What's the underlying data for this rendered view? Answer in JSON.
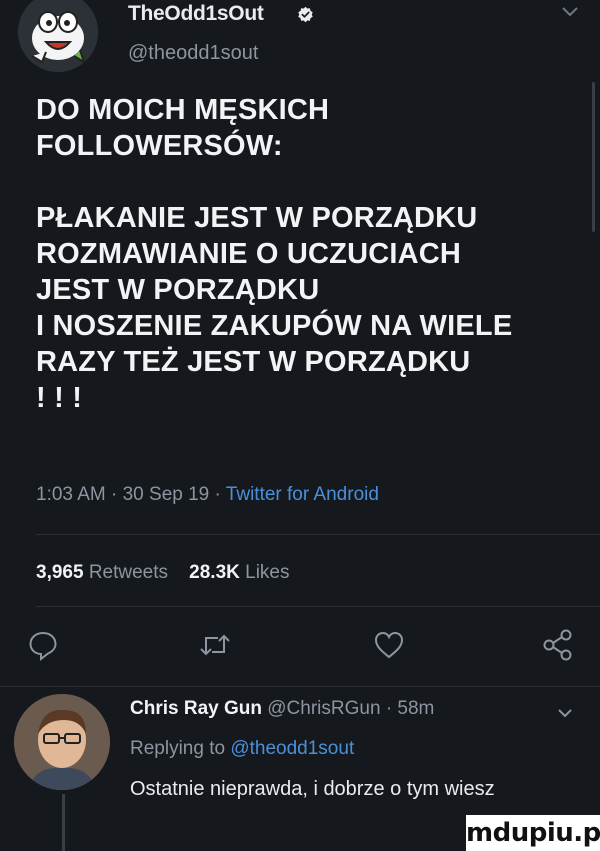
{
  "author": {
    "display_name": "TheOdd1sOut",
    "handle": "@theodd1sout",
    "verified": true
  },
  "tweet": {
    "lines_block1": [
      "DO MOICH MĘSKICH",
      "FOLLOWERSÓW:"
    ],
    "lines_block2": [
      "PŁAKANIE JEST W PORZĄDKU",
      "ROZMAWIANIE O UCZUCIACH",
      "JEST W PORZĄDKU",
      "I NOSZENIE ZAKUPÓW NA WIELE",
      "RAZY TEŻ JEST W PORZĄDKU",
      "! ! !"
    ],
    "time": "1:03 AM",
    "date": "30 Sep 19",
    "source": "Twitter for Android"
  },
  "stats": {
    "retweets_count": "3,965",
    "retweets_label": "Retweets",
    "likes_count": "28.3K",
    "likes_label": "Likes"
  },
  "actions": [
    "reply-icon",
    "retweet-icon",
    "like-icon",
    "share-icon"
  ],
  "reply": {
    "name": "Chris Ray Gun",
    "handle": "@ChrisRGun",
    "age": "58m",
    "replying_prefix": "Replying to",
    "replying_to": "@theodd1sout",
    "text": "Ostatnie nieprawda, i dobrze o tym wiesz"
  },
  "watermark": "mdupiu.pl",
  "colors": {
    "background": "#15181c",
    "link": "#4a90d9",
    "muted": "#8c95a0"
  }
}
